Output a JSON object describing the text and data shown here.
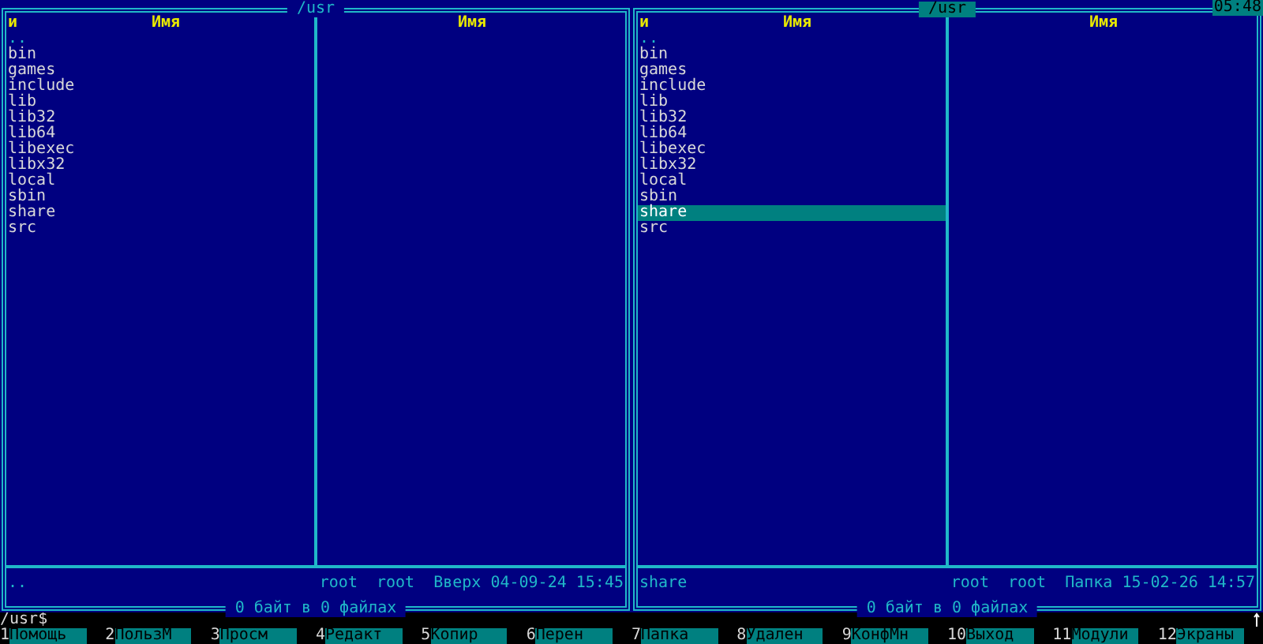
{
  "panels": [
    {
      "title": "/usr",
      "active": false,
      "sort_mark": "и",
      "columns": [
        "Имя",
        "Имя"
      ],
      "files": [
        {
          "name": "..",
          "kind": "up",
          "selected": false
        },
        {
          "name": "bin",
          "kind": "dir",
          "selected": false
        },
        {
          "name": "games",
          "kind": "dir",
          "selected": false
        },
        {
          "name": "include",
          "kind": "dir",
          "selected": false
        },
        {
          "name": "lib",
          "kind": "dir",
          "selected": false
        },
        {
          "name": "lib32",
          "kind": "dir",
          "selected": false
        },
        {
          "name": "lib64",
          "kind": "dir",
          "selected": false
        },
        {
          "name": "libexec",
          "kind": "dir",
          "selected": false
        },
        {
          "name": "libx32",
          "kind": "dir",
          "selected": false
        },
        {
          "name": "local",
          "kind": "dir",
          "selected": false
        },
        {
          "name": "sbin",
          "kind": "dir",
          "selected": false
        },
        {
          "name": "share",
          "kind": "dir",
          "selected": false
        },
        {
          "name": "src",
          "kind": "dir",
          "selected": false
        }
      ],
      "status": {
        "name": "..",
        "owner": "root",
        "group": "root",
        "info": "Вверх 04-09-24 15:45"
      },
      "footer": "0 байт в 0 файлах"
    },
    {
      "title": "/usr",
      "active": true,
      "sort_mark": "и",
      "columns": [
        "Имя",
        "Имя"
      ],
      "files": [
        {
          "name": "..",
          "kind": "up",
          "selected": false
        },
        {
          "name": "bin",
          "kind": "dir",
          "selected": false
        },
        {
          "name": "games",
          "kind": "dir",
          "selected": false
        },
        {
          "name": "include",
          "kind": "dir",
          "selected": false
        },
        {
          "name": "lib",
          "kind": "dir",
          "selected": false
        },
        {
          "name": "lib32",
          "kind": "dir",
          "selected": false
        },
        {
          "name": "lib64",
          "kind": "dir",
          "selected": false
        },
        {
          "name": "libexec",
          "kind": "dir",
          "selected": false
        },
        {
          "name": "libx32",
          "kind": "dir",
          "selected": false
        },
        {
          "name": "local",
          "kind": "dir",
          "selected": false
        },
        {
          "name": "sbin",
          "kind": "dir",
          "selected": false
        },
        {
          "name": "share",
          "kind": "dir",
          "selected": true
        },
        {
          "name": "src",
          "kind": "dir",
          "selected": false
        }
      ],
      "status": {
        "name": "share",
        "owner": "root",
        "group": "root",
        "info": "Папка 15-02-26 14:57"
      },
      "footer": "0 байт в 0 файлах"
    }
  ],
  "clock": "05:48",
  "command_line": {
    "prompt": "/usr$"
  },
  "keybar": [
    {
      "num": "1",
      "label": "Помощь"
    },
    {
      "num": "2",
      "label": "ПользМ"
    },
    {
      "num": "3",
      "label": "Просм"
    },
    {
      "num": "4",
      "label": "Редакт"
    },
    {
      "num": "5",
      "label": "Копир"
    },
    {
      "num": "6",
      "label": "Перен"
    },
    {
      "num": "7",
      "label": "Папка"
    },
    {
      "num": "8",
      "label": "Удален"
    },
    {
      "num": "9",
      "label": "КонфМн"
    },
    {
      "num": "10",
      "label": "Выход"
    },
    {
      "num": "11",
      "label": "Модули"
    },
    {
      "num": "12",
      "label": "Экраны"
    }
  ]
}
